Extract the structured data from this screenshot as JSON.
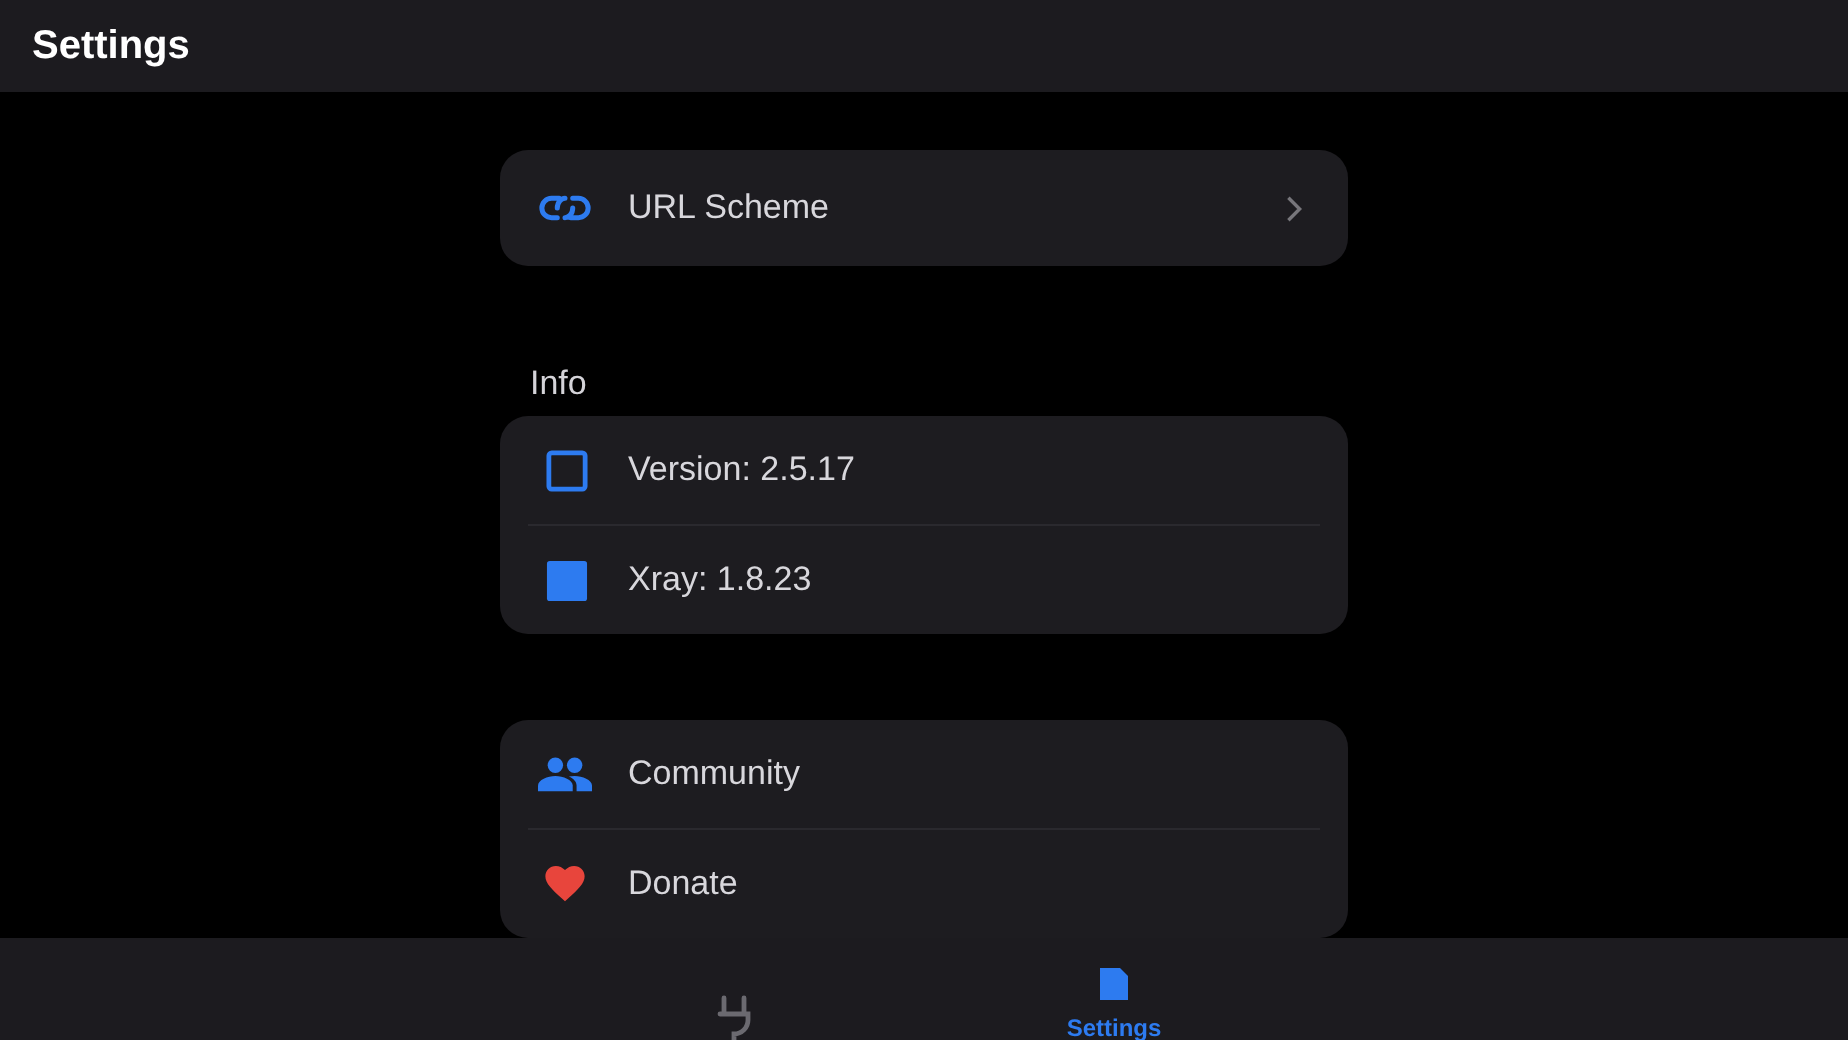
{
  "app_bar": {
    "title": "Settings"
  },
  "sections": [
    {
      "items": [
        {
          "label": "URL Scheme",
          "kind": "link"
        }
      ]
    },
    {
      "header": "Info",
      "items": [
        {
          "label": "Version: 2.5.17",
          "kind": "plain"
        },
        {
          "label": "Xray: 1.8.23",
          "kind": "plain"
        }
      ]
    },
    {
      "items": [
        {
          "label": "Community",
          "kind": "plain"
        },
        {
          "label": "Donate",
          "kind": "plain"
        }
      ]
    }
  ],
  "bottom_tabs": [
    {
      "selected": false
    },
    {
      "label": "Settings",
      "selected": true
    }
  ]
}
